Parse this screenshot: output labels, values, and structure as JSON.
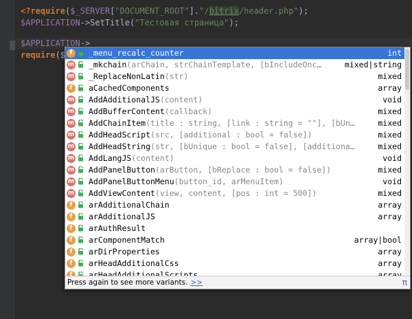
{
  "editor": {
    "line1": {
      "open_tag": "<?",
      "keyword": "require",
      "paren_open": "(",
      "var": "$_SERVER",
      "bracket_open": "[",
      "key": "\"DOCUMENT_ROOT\"",
      "bracket_close": "]",
      "concat": ".",
      "path_a": "\"/",
      "path_b": "bitrix",
      "path_c": "/header.php\"",
      "close": ");"
    },
    "line2": {
      "var": "$APPLICATION",
      "rest": "->SetTitle(",
      "str": "\"Тестовая страница\"",
      "close": ");"
    },
    "line3": {
      "var": "$APPLICATION",
      "rest": "->"
    },
    "line4": {
      "keyword": "require",
      "paren_open": "($"
    }
  },
  "completion": {
    "items": [
      {
        "kind": "f",
        "name": "_menu_recalc_counter",
        "params": "",
        "type": "int"
      },
      {
        "kind": "m",
        "name": "_mkchain",
        "params": "(arChain, strChainTemplate, [bIncludeOnc…",
        "type": "mixed|string"
      },
      {
        "kind": "m",
        "name": "_ReplaceNonLatin",
        "params": "(str)",
        "type": "mixed"
      },
      {
        "kind": "f",
        "name": "aCachedComponents",
        "params": "",
        "type": "array"
      },
      {
        "kind": "m",
        "name": "AddAdditionalJS",
        "params": "(content)",
        "type": "void"
      },
      {
        "kind": "m",
        "name": "AddBufferContent",
        "params": "(callback)",
        "type": "mixed"
      },
      {
        "kind": "m",
        "name": "AddChainItem",
        "params": "(title : string, [link : string = \"\"], [bUn…",
        "type": "mixed"
      },
      {
        "kind": "m",
        "name": "AddHeadScript",
        "params": "(src, [additional : bool = false])",
        "type": "mixed"
      },
      {
        "kind": "m",
        "name": "AddHeadString",
        "params": "(str, [bUnique : bool = false], [additiona…",
        "type": "mixed"
      },
      {
        "kind": "m",
        "name": "AddLangJS",
        "params": "(content)",
        "type": "void"
      },
      {
        "kind": "m",
        "name": "AddPanelButton",
        "params": "(arButton, [bReplace : bool = false])",
        "type": "mixed"
      },
      {
        "kind": "m",
        "name": "AddPanelButtonMenu",
        "params": "(button_id, arMenuItem)",
        "type": "void"
      },
      {
        "kind": "m",
        "name": "AddViewContent",
        "params": "(view, content, [pos : int = 500])",
        "type": "mixed"
      },
      {
        "kind": "f",
        "name": "arAdditionalChain",
        "params": "",
        "type": "array"
      },
      {
        "kind": "f",
        "name": "arAdditionalJS",
        "params": "",
        "type": "array"
      },
      {
        "kind": "f",
        "name": "arAuthResult",
        "params": "",
        "type": ""
      },
      {
        "kind": "f",
        "name": "arComponentMatch",
        "params": "",
        "type": "array|bool"
      },
      {
        "kind": "f",
        "name": "arDirProperties",
        "params": "",
        "type": "array"
      },
      {
        "kind": "f",
        "name": "arHeadAdditionalCss",
        "params": "",
        "type": "array"
      },
      {
        "kind": "f",
        "name": "arHeadAdditionalScripts",
        "params": "",
        "type": "array"
      }
    ],
    "footer_text": "Press again to see more variants.",
    "footer_link": ">>",
    "footer_icon": "π",
    "colors": {
      "selection": "#3875d7",
      "field_icon": "#e8a04a",
      "method_icon": "#d9746f"
    }
  }
}
